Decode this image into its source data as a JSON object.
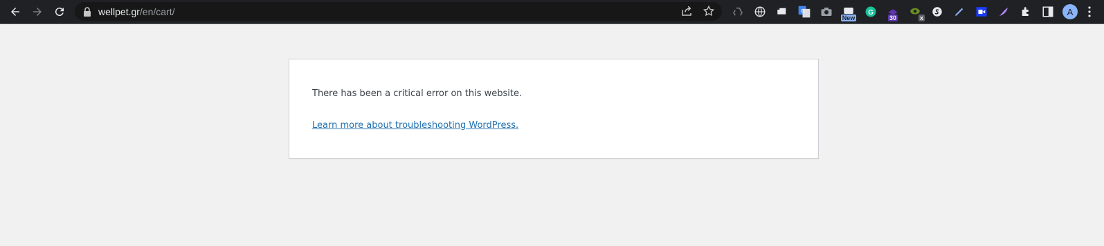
{
  "browser": {
    "url_host": "wellpet.gr",
    "url_path": "/en/cart/",
    "extensions": [
      {
        "icon": "recycle-icon"
      },
      {
        "icon": "globe-icon"
      },
      {
        "icon": "car-icon"
      },
      {
        "icon": "google-translate-icon"
      },
      {
        "icon": "camera-icon"
      },
      {
        "icon": "news-icon",
        "badge": "New"
      },
      {
        "icon": "grammarly-icon"
      },
      {
        "icon": "hat-icon",
        "badge": "30"
      },
      {
        "icon": "eye-icon",
        "badge": "x"
      },
      {
        "icon": "s-logo-icon"
      },
      {
        "icon": "pen-icon"
      },
      {
        "icon": "screen-record-icon"
      },
      {
        "icon": "feather-icon"
      },
      {
        "icon": "puzzle-icon"
      },
      {
        "icon": "side-panel-icon"
      }
    ],
    "avatar_letter": "A"
  },
  "error": {
    "message": "There has been a critical error on this website.",
    "link": "Learn more about troubleshooting WordPress."
  },
  "colors": {
    "toolbar": "#202124",
    "page_bg": "#f1f1f1",
    "link": "#2271b1",
    "text": "#3c434a"
  }
}
